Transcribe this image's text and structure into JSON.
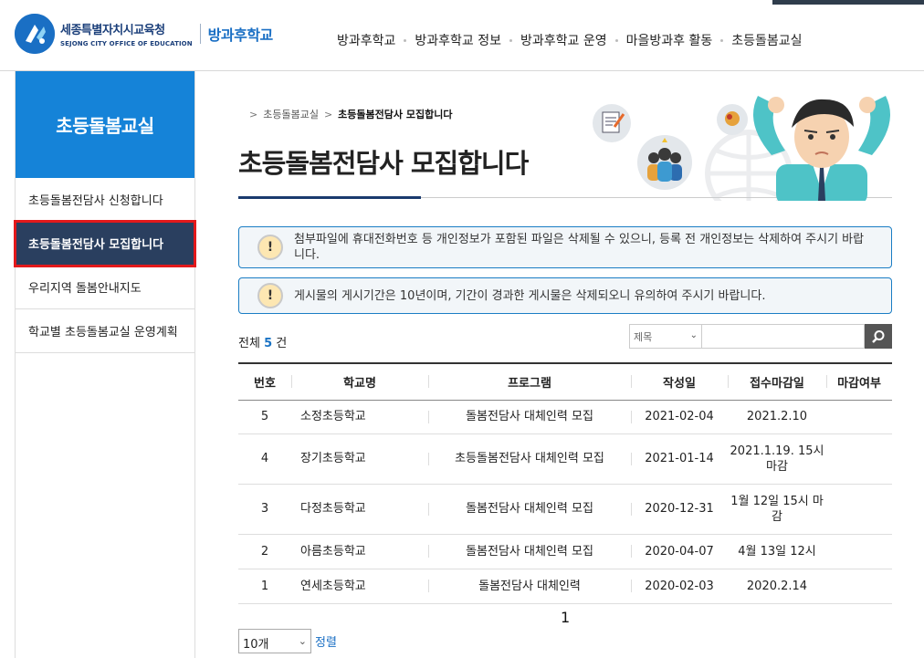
{
  "header": {
    "logo_ko": "세종특별자치시교육청",
    "logo_en": "SEJONG CITY OFFICE OF EDUCATION",
    "logo_sub": "방과후학교",
    "nav": [
      "방과후학교",
      "방과후학교 정보",
      "방과후학교 운영",
      "마을방과후 활동",
      "초등돌봄교실"
    ]
  },
  "sidebar": {
    "title": "초등돌봄교실",
    "items": [
      {
        "label": "초등돌봄전담사 신청합니다"
      },
      {
        "label": "초등돌봄전담사 모집합니다"
      },
      {
        "label": "우리지역 돌봄안내지도"
      },
      {
        "label": "학교별 초등돌봄교실 운영계획"
      }
    ]
  },
  "breadcrumb": {
    "parent": "초등돌봄교실",
    "current": "초등돌봄전담사 모집합니다"
  },
  "page_title": "초등돌봄전담사 모집합니다",
  "notices": [
    {
      "text": "첨부파일에 휴대전화번호 등 개인정보가 포함된 파일은 삭제될 수 있으니, 등록 전 개인정보는 삭제하여 주시기 바랍니다."
    },
    {
      "text": "게시물의 게시기간은 10년이며, 기간이 경과한 게시물은 삭제되오니 유의하여 주시기 바랍니다."
    }
  ],
  "total": {
    "prefix": "전체",
    "count": "5",
    "suffix": "건"
  },
  "search": {
    "field": "제목",
    "value": ""
  },
  "table": {
    "headers": [
      "번호",
      "학교명",
      "프로그램",
      "작성일",
      "접수마감일",
      "마감여부"
    ],
    "rows": [
      {
        "no": "5",
        "school": "소정초등학교",
        "program": "돌봄전담사 대체인력 모집",
        "date": "2021-02-04",
        "deadline": "2021.2.10",
        "status": ""
      },
      {
        "no": "4",
        "school": "장기초등학교",
        "program": "초등돌봄전담사 대체인력 모집",
        "date": "2021-01-14",
        "deadline": "2021.1.19. 15시 마감",
        "status": ""
      },
      {
        "no": "3",
        "school": "다정초등학교",
        "program": "돌봄전담사 대체인력 모집",
        "date": "2020-12-31",
        "deadline": "1월 12일 15시 마감",
        "status": ""
      },
      {
        "no": "2",
        "school": "아름초등학교",
        "program": "돌봄전담사 대체인력 모집",
        "date": "2020-04-07",
        "deadline": "4월 13일 12시",
        "status": ""
      },
      {
        "no": "1",
        "school": "연세초등학교",
        "program": "돌봄전담사 대체인력",
        "date": "2020-02-03",
        "deadline": "2020.2.14",
        "status": ""
      }
    ]
  },
  "pagination": {
    "current": "1"
  },
  "page_size": {
    "value": "10개"
  },
  "sort_label": "정렬",
  "colors": {
    "primary": "#1583d8",
    "active_bg": "#2a3f5f",
    "highlight": "#e3191b"
  }
}
